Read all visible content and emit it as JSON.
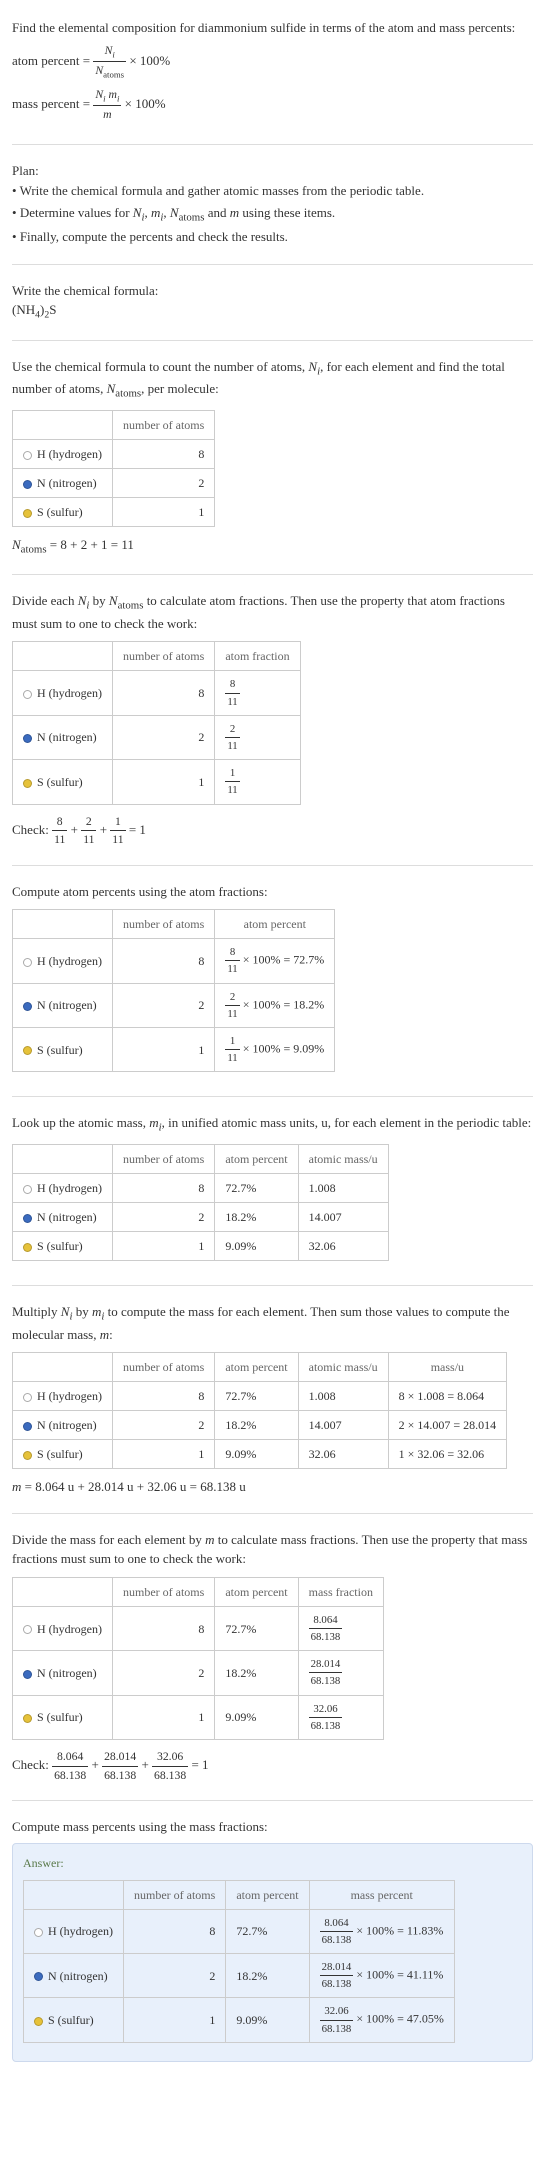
{
  "intro": {
    "question": "Find the elemental composition for diammonium sulfide in terms of the atom and mass percents:",
    "atom_percent_label": "atom percent = ",
    "atom_percent_frac_num": "N_i",
    "atom_percent_frac_den": "N_atoms",
    "times100": " × 100%",
    "mass_percent_label": "mass percent = ",
    "mass_percent_frac_num": "N_i m_i",
    "mass_percent_frac_den": "m"
  },
  "plan": {
    "title": "Plan:",
    "p1": "Write the chemical formula and gather atomic masses from the periodic table.",
    "p2": "Determine values for N_i, m_i, N_atoms and m using these items.",
    "p3": "Finally, compute the percents and check the results."
  },
  "step_formula": {
    "t": "Write the chemical formula:",
    "f": "(NH_4)_2S"
  },
  "step_count": {
    "t": "Use the chemical formula to count the number of atoms, N_i, for each element and find the total number of atoms, N_atoms, per molecule:",
    "h_num": "number of atoms",
    "rows": [
      {
        "el": "H (hydrogen)",
        "dot": "h",
        "n": "8"
      },
      {
        "el": "N (nitrogen)",
        "dot": "n",
        "n": "2"
      },
      {
        "el": "S (sulfur)",
        "dot": "s",
        "n": "1"
      }
    ],
    "eq": "N_atoms = 8 + 2 + 1 = 11"
  },
  "step_atomfrac": {
    "t": "Divide each N_i by N_atoms to calculate atom fractions. Then use the property that atom fractions must sum to one to check the work:",
    "h_num": "number of atoms",
    "h_af": "atom fraction",
    "rows": [
      {
        "el": "H (hydrogen)",
        "dot": "h",
        "n": "8",
        "fn": "8",
        "fd": "11"
      },
      {
        "el": "N (nitrogen)",
        "dot": "n",
        "n": "2",
        "fn": "2",
        "fd": "11"
      },
      {
        "el": "S (sulfur)",
        "dot": "s",
        "n": "1",
        "fn": "1",
        "fd": "11"
      }
    ],
    "check_label": "Check: ",
    "check_eq": " = 1"
  },
  "step_atompct": {
    "t": "Compute atom percents using the atom fractions:",
    "h_num": "number of atoms",
    "h_ap": "atom percent",
    "rows": [
      {
        "el": "H (hydrogen)",
        "dot": "h",
        "n": "8",
        "fn": "8",
        "fd": "11",
        "r": "72.7%"
      },
      {
        "el": "N (nitrogen)",
        "dot": "n",
        "n": "2",
        "fn": "2",
        "fd": "11",
        "r": "18.2%"
      },
      {
        "el": "S (sulfur)",
        "dot": "s",
        "n": "1",
        "fn": "1",
        "fd": "11",
        "r": "9.09%"
      }
    ]
  },
  "step_mass": {
    "t": "Look up the atomic mass, m_i, in unified atomic mass units, u, for each element in the periodic table:",
    "h_num": "number of atoms",
    "h_ap": "atom percent",
    "h_am": "atomic mass/u",
    "rows": [
      {
        "el": "H (hydrogen)",
        "dot": "h",
        "n": "8",
        "ap": "72.7%",
        "am": "1.008"
      },
      {
        "el": "N (nitrogen)",
        "dot": "n",
        "n": "2",
        "ap": "18.2%",
        "am": "14.007"
      },
      {
        "el": "S (sulfur)",
        "dot": "s",
        "n": "1",
        "ap": "9.09%",
        "am": "32.06"
      }
    ]
  },
  "step_mult": {
    "t": "Multiply N_i by m_i to compute the mass for each element. Then sum those values to compute the molecular mass, m:",
    "h_num": "number of atoms",
    "h_ap": "atom percent",
    "h_am": "atomic mass/u",
    "h_m": "mass/u",
    "rows": [
      {
        "el": "H (hydrogen)",
        "dot": "h",
        "n": "8",
        "ap": "72.7%",
        "am": "1.008",
        "m": "8 × 1.008 = 8.064"
      },
      {
        "el": "N (nitrogen)",
        "dot": "n",
        "n": "2",
        "ap": "18.2%",
        "am": "14.007",
        "m": "2 × 14.007 = 28.014"
      },
      {
        "el": "S (sulfur)",
        "dot": "s",
        "n": "1",
        "ap": "9.09%",
        "am": "32.06",
        "m": "1 × 32.06 = 32.06"
      }
    ],
    "eq": "m = 8.064 u + 28.014 u + 32.06 u = 68.138 u"
  },
  "step_massfrac": {
    "t": "Divide the mass for each element by m to calculate mass fractions. Then use the property that mass fractions must sum to one to check the work:",
    "h_num": "number of atoms",
    "h_ap": "atom percent",
    "h_mf": "mass fraction",
    "rows": [
      {
        "el": "H (hydrogen)",
        "dot": "h",
        "n": "8",
        "ap": "72.7%",
        "fn": "8.064",
        "fd": "68.138"
      },
      {
        "el": "N (nitrogen)",
        "dot": "n",
        "n": "2",
        "ap": "18.2%",
        "fn": "28.014",
        "fd": "68.138"
      },
      {
        "el": "S (sulfur)",
        "dot": "s",
        "n": "1",
        "ap": "9.09%",
        "fn": "32.06",
        "fd": "68.138"
      }
    ],
    "check_label": "Check: ",
    "check_eq": " = 1"
  },
  "step_masspct": {
    "t": "Compute mass percents using the mass fractions:",
    "answer": "Answer:",
    "h_num": "number of atoms",
    "h_ap": "atom percent",
    "h_mp": "mass percent",
    "rows": [
      {
        "el": "H (hydrogen)",
        "dot": "h",
        "n": "8",
        "ap": "72.7%",
        "fn": "8.064",
        "fd": "68.138",
        "r": "11.83%"
      },
      {
        "el": "N (nitrogen)",
        "dot": "n",
        "n": "2",
        "ap": "18.2%",
        "fn": "28.014",
        "fd": "68.138",
        "r": "41.11%"
      },
      {
        "el": "S (sulfur)",
        "dot": "s",
        "n": "1",
        "ap": "9.09%",
        "fn": "32.06",
        "fd": "68.138",
        "r": "47.05%"
      }
    ]
  }
}
